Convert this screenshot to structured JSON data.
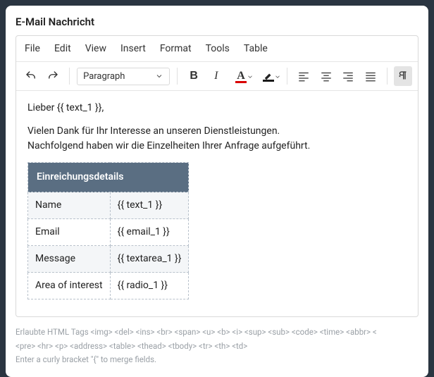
{
  "title": "E-Mail Nachricht",
  "menu": {
    "file": "File",
    "edit": "Edit",
    "view": "View",
    "insert": "Insert",
    "format": "Format",
    "tools": "Tools",
    "table": "Table"
  },
  "toolbar": {
    "paragraph_label": "Paragraph",
    "bold": "B",
    "italic": "I",
    "textcolor": "A",
    "hilite": "✎"
  },
  "body": {
    "greeting": "Lieber {{ text_1 }},",
    "para1": "Vielen Dank für Ihr Interesse an unseren Dienstleistungen.",
    "para2": "Nachfolgend haben wir die Einzelheiten Ihrer Anfrage aufgeführt."
  },
  "details": {
    "header": "Einreichungsdetails",
    "rows": [
      {
        "k": "Name",
        "v": "{{ text_1 }}"
      },
      {
        "k": "Email",
        "v": "{{ email_1 }}"
      },
      {
        "k": "Message",
        "v": "{{ textarea_1 }}"
      },
      {
        "k": "Area of interest",
        "v": "{{ radio_1 }}"
      }
    ]
  },
  "hints": {
    "l1": "Erlaubte HTML Tags <img> <del> <ins> <br> <span> <u> <b> <i> <sup> <sub> <code> <time> <abbr> <",
    "l2": "<pre> <hr> <p> <address> <table> <thead> <tbody> <tr> <th> <td>",
    "l3": "Enter a curly bracket \"{\" to merge fields."
  }
}
